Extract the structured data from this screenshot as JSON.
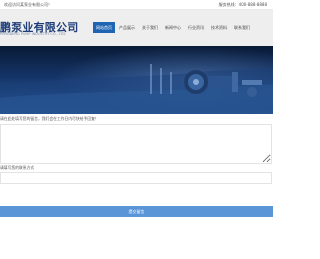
{
  "topbar": {
    "welcome": "欢迎访问某泵业有限公司！",
    "hotline": "服务热线：400-888-8888"
  },
  "header": {
    "company_name": "鹏泵业有限公司",
    "company_sub": "PENGBENG PUMP INDUSTRY CO., LTD."
  },
  "nav": {
    "items": [
      {
        "label": "网站首页"
      },
      {
        "label": "产品展示"
      },
      {
        "label": "关于我们"
      },
      {
        "label": "新闻中心"
      },
      {
        "label": "行业资讯"
      },
      {
        "label": "技术资料"
      },
      {
        "label": "联系我们"
      }
    ]
  },
  "form": {
    "tip": "请在此处填写您的留言，我们会在工作日内尽快给予回复！",
    "message_placeholder": "",
    "contact_label": "请填写您的联系方式",
    "contact_placeholder": "",
    "submit_label": "提交留言"
  },
  "colors": {
    "nav_active": "#1f65b3",
    "logo": "#1e3d78",
    "submit": "#5a95d8"
  }
}
